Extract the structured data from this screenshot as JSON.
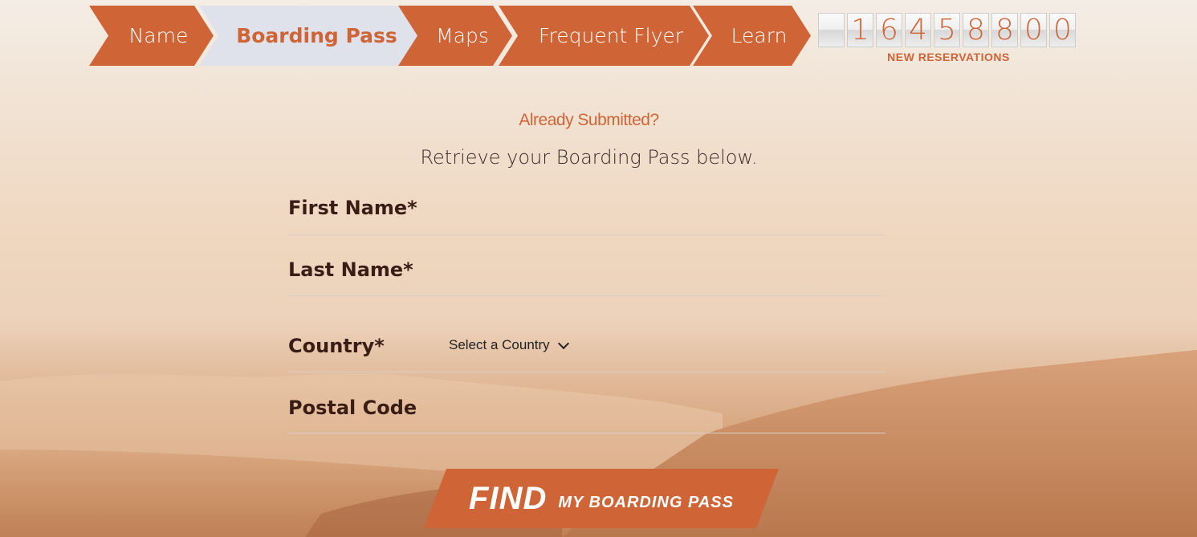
{
  "nav": {
    "items": [
      {
        "label": "Name"
      },
      {
        "label": "Boarding Pass"
      },
      {
        "label": "Maps"
      },
      {
        "label": "Frequent Flyer"
      },
      {
        "label": "Learn"
      }
    ],
    "active_index": 1
  },
  "counter": {
    "digits": [
      "",
      "1",
      "6",
      "4",
      "5",
      "8",
      "8",
      "0",
      "0"
    ],
    "label": "NEW RESERVATIONS"
  },
  "form": {
    "heading": "Already Submitted?",
    "subheading": "Retrieve your Boarding Pass below.",
    "first_name_label": "First Name*",
    "last_name_label": "Last Name*",
    "country_label": "Country*",
    "country_select_value": "Select a Country",
    "postal_code_label": "Postal Code",
    "find_big": "FIND",
    "find_small": "MY BOARDING PASS"
  },
  "colors": {
    "accent": "#cf6537",
    "active_tab_bg": "#dfe2ea",
    "text_dark": "#3a1e16"
  }
}
